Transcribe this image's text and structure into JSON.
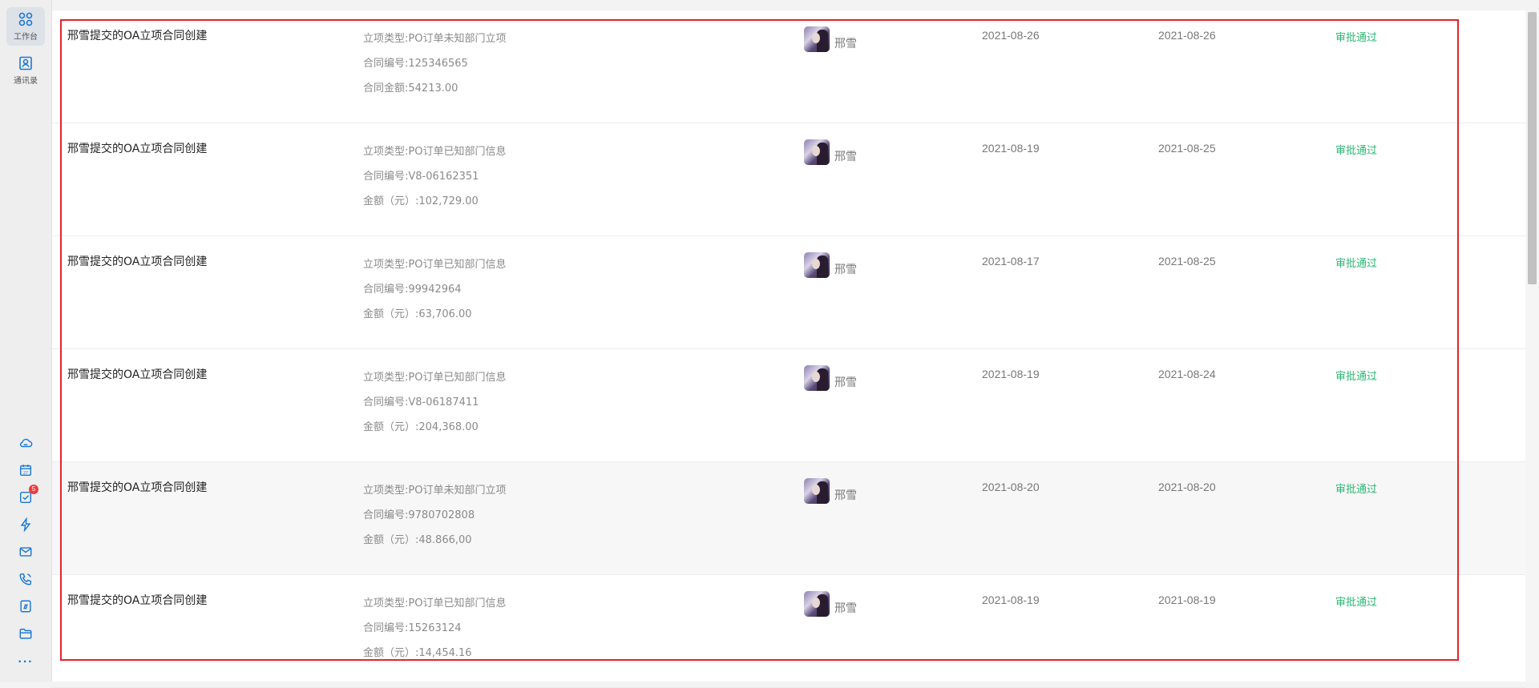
{
  "sidebar": {
    "workbench_label": "工作台",
    "contacts_label": "通讯录",
    "todo_badge": "5",
    "calendar_day": "27",
    "icons": [
      "cloud-icon",
      "calendar-icon",
      "todo-icon",
      "lightning-icon",
      "mail-icon",
      "phone-icon",
      "doc-icon",
      "folder-icon",
      "more-icon"
    ]
  },
  "rows": [
    {
      "title": "邢雪提交的OA立项合同创建",
      "details": [
        "立项类型:PO订单未知部门立项",
        "合同编号:125346565",
        "合同金额:54213.00"
      ],
      "person": "邢雪",
      "date_start": "2021-08-26",
      "date_end": "2021-08-26",
      "status": "审批通过"
    },
    {
      "title": "邢雪提交的OA立项合同创建",
      "details": [
        "立项类型:PO订单已知部门信息",
        "合同编号:V8-06162351",
        "金额（元）:102,729.00"
      ],
      "person": "邢雪",
      "date_start": "2021-08-19",
      "date_end": "2021-08-25",
      "status": "审批通过"
    },
    {
      "title": "邢雪提交的OA立项合同创建",
      "details": [
        "立项类型:PO订单已知部门信息",
        "合同编号:99942964",
        "金额（元）:63,706.00"
      ],
      "person": "邢雪",
      "date_start": "2021-08-17",
      "date_end": "2021-08-25",
      "status": "审批通过"
    },
    {
      "title": "邢雪提交的OA立项合同创建",
      "details": [
        "立项类型:PO订单已知部门信息",
        "合同编号:V8-06187411",
        "金额（元）:204,368.00"
      ],
      "person": "邢雪",
      "date_start": "2021-08-19",
      "date_end": "2021-08-24",
      "status": "审批通过"
    },
    {
      "title": "邢雪提交的OA立项合同创建",
      "details": [
        "立项类型:PO订单未知部门立项",
        "合同编号:9780702808",
        "金额（元）:48.866,00"
      ],
      "person": "邢雪",
      "date_start": "2021-08-20",
      "date_end": "2021-08-20",
      "status": "审批通过"
    },
    {
      "title": "邢雪提交的OA立项合同创建",
      "details": [
        "立项类型:PO订单已知部门信息",
        "合同编号:15263124",
        "金额（元）:14,454.16"
      ],
      "person": "邢雪",
      "date_start": "2021-08-19",
      "date_end": "2021-08-19",
      "status": "审批通过"
    }
  ],
  "colors": {
    "status_approved": "#2bb673",
    "accent": "#1b78d8",
    "highlight_border": "#e3242b"
  }
}
